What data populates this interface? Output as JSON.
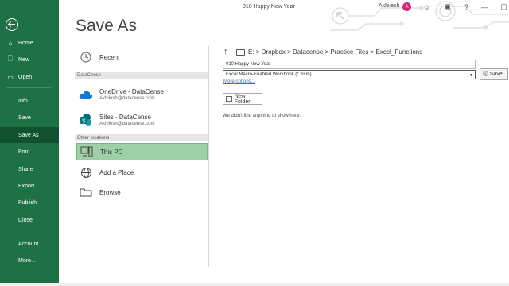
{
  "nav": {
    "back_icon": "back-arrow-icon",
    "items": [
      {
        "label": "Home",
        "icon": "home-icon",
        "glyph": "⌂"
      },
      {
        "label": "New",
        "icon": "new-document-icon",
        "glyph": "🗋"
      },
      {
        "label": "Open",
        "icon": "open-folder-icon",
        "glyph": "▭"
      },
      {
        "label": "Info"
      },
      {
        "label": "Save"
      },
      {
        "label": "Save As"
      },
      {
        "label": "Print"
      },
      {
        "label": "Share"
      },
      {
        "label": "Export"
      },
      {
        "label": "Publish"
      },
      {
        "label": "Close"
      },
      {
        "label": "Account"
      },
      {
        "label": "More..."
      }
    ],
    "color": "#1e7145",
    "active_color": "#10522e"
  },
  "header": {
    "page_title": "Save As",
    "doc_title": "010 Happy New Year",
    "user_name": "Akhilesh",
    "avatar_initial": "A",
    "help": "?"
  },
  "locations": {
    "recent": "Recent",
    "group1": "DataCense",
    "onedrive": {
      "name": "OneDrive - DataCense",
      "email": "Akhilesh@datacense.com"
    },
    "sites": {
      "name": "Sites - DataCense",
      "email": "Akhilesh@datacense.com"
    },
    "group2": "Other locations",
    "this_pc": "This PC",
    "add_place": "Add a Place",
    "browse": "Browse"
  },
  "right": {
    "breadcrumb": "E: > Dropbox > Datacense > Practice Files > Excel_Functions",
    "filename": "010 Happy New Year",
    "filetype": "Excel Macro-Enabled Workbook (*.xlsm)",
    "more_options": "More options...",
    "save_label": "Save",
    "new_folder": "New Folder",
    "empty_message": "We didn't find anything to show here."
  },
  "colors": {
    "accent": "#1e7145",
    "selected": "#9ed0a8",
    "link": "#2e75b6"
  }
}
